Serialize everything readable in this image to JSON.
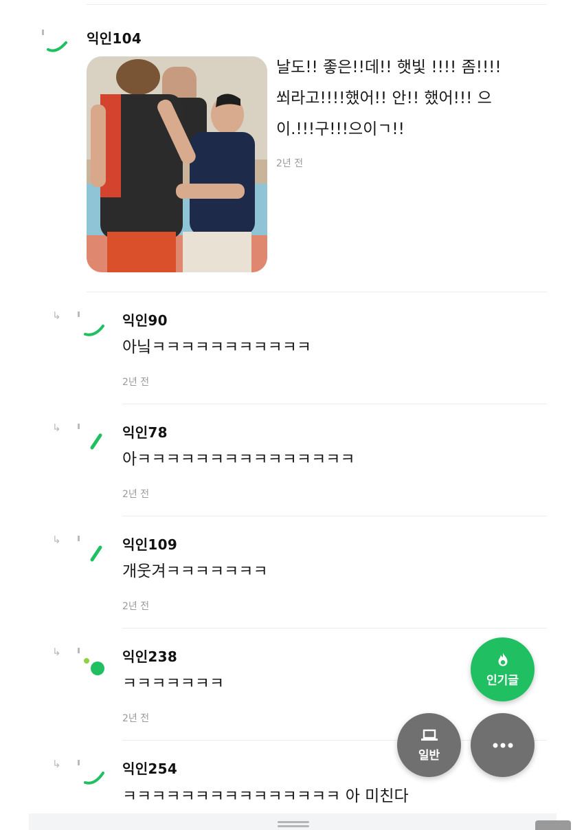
{
  "comments": [
    {
      "author": "익인104",
      "text_lines": [
        "날도!! 좋은!!데!! 햇빛 !!!! 좀!!!!",
        "쐬라고!!!!했어!! 안!! 했어!!! 으",
        "이.!!!구!!!으이ㄱ!!"
      ],
      "time": "2년 전",
      "has_photo": true
    },
    {
      "author": "익인90",
      "text": "아닠ㅋㅋㅋㅋㅋㅋㅋㅋㅋㅋㅋ",
      "time": "2년 전"
    },
    {
      "author": "익인78",
      "text": "아ㅋㅋㅋㅋㅋㅋㅋㅋㅋㅋㅋㅋㅋㅋㅋ",
      "time": "2년 전"
    },
    {
      "author": "익인109",
      "text": "개웃겨ㅋㅋㅋㅋㅋㅋㅋ",
      "time": "2년 전"
    },
    {
      "author": "익인238",
      "text": "ㅋㅋㅋㅋㅋㅋㅋ",
      "time": "2년 전"
    },
    {
      "author": "익인254",
      "text": "ㅋㅋㅋㅋㅋㅋㅋㅋㅋㅋㅋㅋㅋㅋㅋ 아 미친다"
    }
  ],
  "fab": {
    "popular_label": "인기글",
    "general_label": "일반"
  },
  "colors": {
    "accent_green": "#1fbf62",
    "fab_gray": "#707070"
  },
  "icons": {
    "reply": "reply-arrow-icon",
    "popular": "flame-icon",
    "general": "laptop-icon",
    "more": "more-dots-icon"
  }
}
